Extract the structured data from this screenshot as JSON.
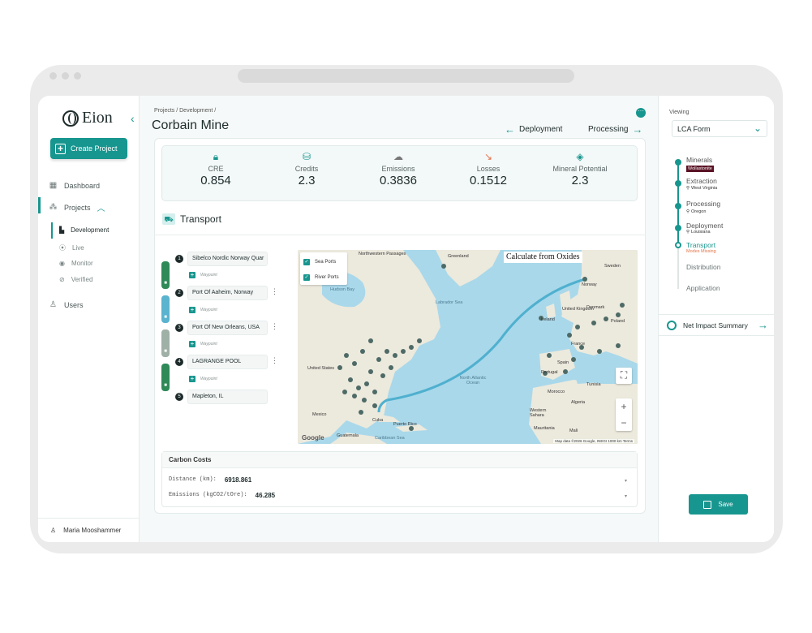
{
  "app": {
    "logo_text": "Eion"
  },
  "sidebar": {
    "create_label": "Create Project",
    "nav": [
      {
        "label": "Dashboard",
        "icon": "dashboard-icon"
      },
      {
        "label": "Projects",
        "icon": "projects-icon"
      },
      {
        "label": "Users",
        "icon": "user-icon"
      }
    ],
    "subnav": [
      "Development",
      "Live",
      "Monitor",
      "Verified"
    ],
    "user_name": "Maria Mooshammer"
  },
  "header": {
    "breadcrumb": "Projects / Development /",
    "title": "Corbain Mine",
    "prev_step": "Deployment",
    "next_step": "Processing"
  },
  "stats": [
    {
      "label": "CRE",
      "value": "0.854",
      "icon": "lock-icon"
    },
    {
      "label": "Credits",
      "value": "2.3",
      "icon": "credits-icon"
    },
    {
      "label": "Emissions",
      "value": "0.3836",
      "icon": "cloud-icon"
    },
    {
      "label": "Losses",
      "value": "0.1512",
      "icon": "trend-down-icon"
    },
    {
      "label": "Mineral Potential",
      "value": "2.3",
      "icon": "diamond-icon"
    }
  ],
  "transport": {
    "title": "Transport",
    "waypoints": [
      {
        "num": "1",
        "name": "Sibelco Nordic Norway Quar"
      },
      {
        "num": "2",
        "name": "Port Of Aaheim, Norway"
      },
      {
        "num": "3",
        "name": "Port Of New Orleans, USA"
      },
      {
        "num": "4",
        "name": "LAGRANGE POOL"
      },
      {
        "num": "5",
        "name": "Mapleton, IL"
      }
    ],
    "add_waypoint": "Waypoint",
    "modes": [
      {
        "color": "#2f8a57"
      },
      {
        "color": "#5ab3cf"
      },
      {
        "color": "#9fb0a7"
      },
      {
        "color": "#2f8a57"
      }
    ]
  },
  "map": {
    "filters": [
      "Sea Ports",
      "River Ports"
    ],
    "calc_label": "Calculate from Oxides",
    "zoom_in": "+",
    "zoom_out": "−",
    "google": "Google",
    "attribution": "Map data ©2026 Google, INEGI   1000 km   Terms",
    "labels": {
      "greenland": "Greenland",
      "hudson": "Hudson Bay",
      "labrador": "Labrador Sea",
      "nw_passages": "Northwestern Passages",
      "united_states": "United States",
      "mexico": "Mexico",
      "cuba": "Cuba",
      "guatemala": "Guatemala",
      "puerto_rico": "Puerto Rico",
      "caribbean": "Caribbean Sea",
      "ocean": "North Atlantic Ocean",
      "norway": "Norway",
      "sweden": "Sweden",
      "denmark": "Denmark",
      "uk": "United Kingdom",
      "ireland": "Ireland",
      "poland": "Poland",
      "france": "France",
      "spain": "Spain",
      "portugal": "Portugal",
      "morocco": "Morocco",
      "algeria": "Algeria",
      "tunisia": "Tunisia",
      "western_sahara": "Western Sahara",
      "mauritania": "Mauritania",
      "mali": "Mali"
    },
    "colors": {
      "ocean": "#a9d8ea",
      "land": "#ece9dd",
      "route": "#4fb0cf",
      "port": "#4e6a66"
    }
  },
  "carbon": {
    "title": "Carbon Costs",
    "rows": [
      {
        "label": "Distance (km):",
        "value": "6918.861"
      },
      {
        "label": "Emissions (kgCO2/tOre):",
        "value": "46.285"
      }
    ]
  },
  "right": {
    "viewing_label": "Viewing",
    "form": "LCA Form",
    "steps": [
      {
        "label": "Minerals",
        "sub": ""
      },
      {
        "label": "Extraction",
        "sub": "West Virginia"
      },
      {
        "label": "Processing",
        "sub": "Oregon"
      },
      {
        "label": "Deployment",
        "sub": "Louisiana"
      },
      {
        "label": "Transport",
        "sub": "Modes Missing"
      },
      {
        "label": "Distribution",
        "sub": ""
      },
      {
        "label": "Application",
        "sub": ""
      }
    ],
    "mineral_badge": "Wollastonite",
    "impact_label": "Net Impact Summary",
    "save_label": "Save"
  },
  "theme": {
    "accent": "#17968f",
    "warning": "#e3734a"
  }
}
